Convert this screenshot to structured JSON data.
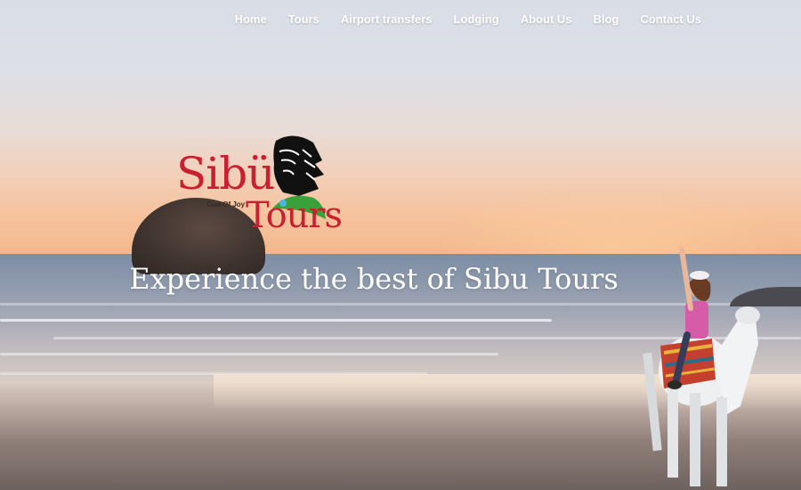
{
  "nav": {
    "items": [
      {
        "label": "Home"
      },
      {
        "label": "Tours"
      },
      {
        "label": "Airport transfers"
      },
      {
        "label": "Lodging"
      },
      {
        "label": "About Us"
      },
      {
        "label": "Blog"
      },
      {
        "label": "Contact Us"
      }
    ]
  },
  "logo": {
    "brand_top": "Sibü",
    "brand_bottom": "Tours",
    "tagline": "God Of Joy"
  },
  "hero": {
    "title": "Experience the best of Sibu Tours"
  },
  "colors": {
    "logo_red": "#c8202f",
    "nav_text": "#ffffff",
    "logo_leaf_green": "#3aa03a"
  }
}
